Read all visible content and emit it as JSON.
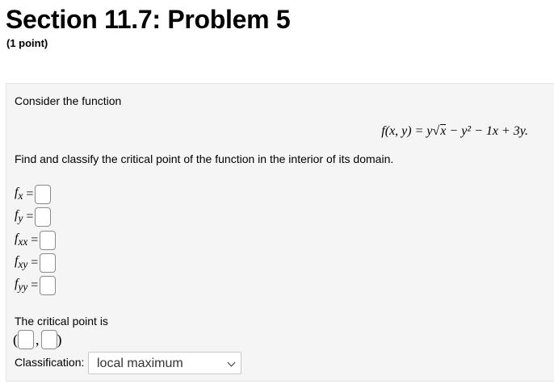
{
  "header": {
    "title": "Section 11.7: Problem 5",
    "points": "(1 point)"
  },
  "problem": {
    "intro": "Consider the function",
    "instruction": "Find and classify the critical point of the function in the interior of its domain.",
    "partials": [
      {
        "label": "f",
        "sub": "x"
      },
      {
        "label": "f",
        "sub": "y"
      },
      {
        "label": "f",
        "sub": "xx"
      },
      {
        "label": "f",
        "sub": "xy"
      },
      {
        "label": "f",
        "sub": "yy"
      }
    ],
    "equals": "=",
    "critical_point_text": "The critical point is",
    "classification_label": "Classification:",
    "classification_value": "local maximum",
    "formula": {
      "lhs": "f(x, y) = y",
      "rad": "x",
      "rest": " − y² − 1x + 3y."
    }
  }
}
